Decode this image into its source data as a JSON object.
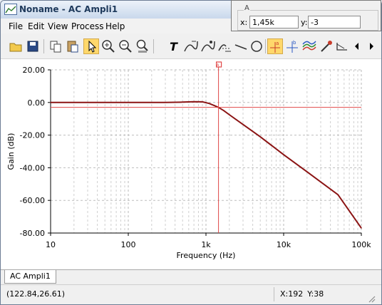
{
  "window": {
    "title": "Noname - AC Ampli1"
  },
  "menu": [
    "File",
    "Edit",
    "View",
    "Process",
    "Help"
  ],
  "cursor_panel": {
    "name": "A",
    "x_label": "x:",
    "x_value": "1,45k",
    "y_label": "y:",
    "y_value": "-3"
  },
  "chart_data": {
    "type": "line",
    "ylabel": "Gain (dB)",
    "xlabel": "Frequency (Hz)",
    "xscale": "log",
    "xlim": [
      10,
      100000
    ],
    "ylim": [
      -80,
      20
    ],
    "xticks": [
      "10",
      "100",
      "1k",
      "10k",
      "100k"
    ],
    "yticks": [
      "20.00",
      "0.00",
      "-20.00",
      "-40.00",
      "-60.00",
      "-80.00"
    ],
    "grid": true,
    "series": [
      {
        "color": "#8b1414",
        "x": [
          10,
          100,
          300,
          500,
          700,
          900,
          1100,
          1300,
          1450,
          1700,
          2000,
          3000,
          5000,
          10000,
          20000,
          50000,
          100000
        ],
        "y": [
          0,
          0,
          0,
          0.2,
          0.5,
          0.4,
          -0.6,
          -2,
          -3,
          -5,
          -7.5,
          -13.5,
          -21,
          -32,
          -42.5,
          -56.5,
          -77
        ]
      }
    ],
    "cursor": {
      "name": "A",
      "x": 1450,
      "y": -3,
      "color": "#e04848"
    }
  },
  "tab": {
    "label": "AC Ampli1"
  },
  "status": {
    "coords": "(122.84,26.61)",
    "x": "X:192",
    "y": "Y:38"
  }
}
